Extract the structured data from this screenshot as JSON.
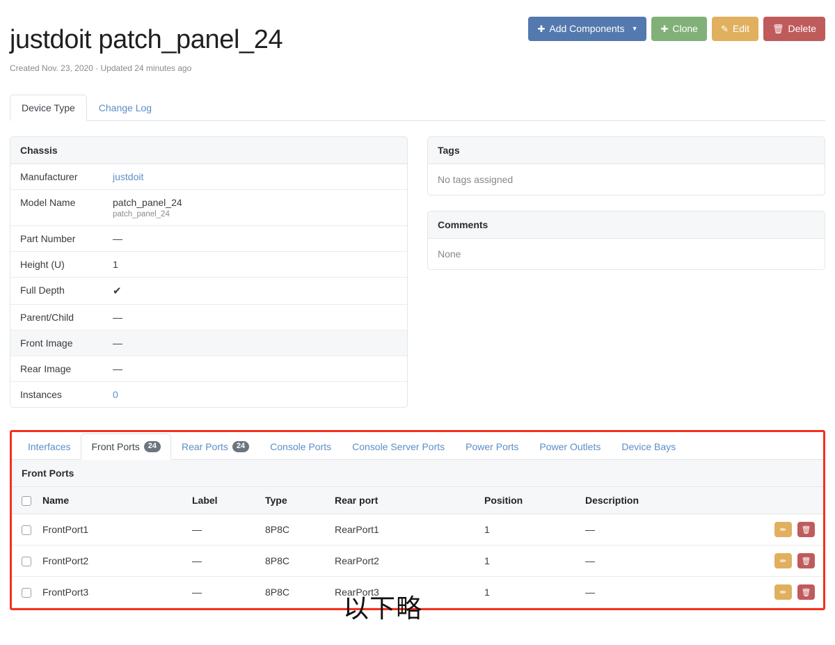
{
  "header": {
    "title": "justdoit patch_panel_24",
    "subtitle": "Created Nov. 23, 2020 · Updated 24 minutes ago",
    "buttons": [
      {
        "label": "Add Components",
        "icon": "plus-icon",
        "color": "#5479ae",
        "caret": true
      },
      {
        "label": "Clone",
        "icon": "plus-icon",
        "color": "#81b179",
        "caret": false
      },
      {
        "label": "Edit",
        "icon": "pencil-icon",
        "color": "#e0b05f",
        "caret": false
      },
      {
        "label": "Delete",
        "icon": "trash-icon",
        "color": "#bf5b5b",
        "caret": false
      }
    ]
  },
  "tabs": [
    {
      "label": "Device Type",
      "active": true
    },
    {
      "label": "Change Log",
      "active": false
    }
  ],
  "chassis": {
    "title": "Chassis",
    "rows": [
      {
        "key": "Manufacturer",
        "value": "justdoit",
        "link": true,
        "sub": ""
      },
      {
        "key": "Model Name",
        "value": "patch_panel_24",
        "link": false,
        "sub": "patch_panel_24"
      },
      {
        "key": "Part Number",
        "value": "—",
        "link": false,
        "sub": ""
      },
      {
        "key": "Height (U)",
        "value": "1",
        "link": false,
        "sub": ""
      },
      {
        "key": "Full Depth",
        "value": "✔",
        "link": false,
        "sub": ""
      },
      {
        "key": "Parent/Child",
        "value": "—",
        "link": false,
        "sub": ""
      },
      {
        "key": "Front Image",
        "value": "—",
        "link": false,
        "sub": ""
      },
      {
        "key": "Rear Image",
        "value": "—",
        "link": false,
        "sub": ""
      },
      {
        "key": "Instances",
        "value": "0",
        "link": true,
        "sub": ""
      }
    ]
  },
  "tags": {
    "title": "Tags",
    "body": "No tags assigned"
  },
  "comments": {
    "title": "Comments",
    "body": "None"
  },
  "components": {
    "tabs": [
      {
        "label": "Interfaces",
        "badge": "",
        "active": false
      },
      {
        "label": "Front Ports",
        "badge": "24",
        "active": true
      },
      {
        "label": "Rear Ports",
        "badge": "24",
        "active": false
      },
      {
        "label": "Console Ports",
        "badge": "",
        "active": false
      },
      {
        "label": "Console Server Ports",
        "badge": "",
        "active": false
      },
      {
        "label": "Power Ports",
        "badge": "",
        "active": false
      },
      {
        "label": "Power Outlets",
        "badge": "",
        "active": false
      },
      {
        "label": "Device Bays",
        "badge": "",
        "active": false
      }
    ],
    "panel_title": "Front Ports",
    "columns": [
      "Name",
      "Label",
      "Type",
      "Rear port",
      "Position",
      "Description"
    ],
    "rows": [
      {
        "name": "FrontPort1",
        "label": "—",
        "type": "8P8C",
        "rear_port": "RearPort1",
        "position": "1",
        "description": "—"
      },
      {
        "name": "FrontPort2",
        "label": "—",
        "type": "8P8C",
        "rear_port": "RearPort2",
        "position": "1",
        "description": "—"
      },
      {
        "name": "FrontPort3",
        "label": "—",
        "type": "8P8C",
        "rear_port": "RearPort3",
        "position": "1",
        "description": "—"
      }
    ],
    "row_actions": {
      "edit": "✏",
      "delete": "🗑"
    }
  },
  "annotation": {
    "text": "以下略",
    "highlight_color": "#f4301f"
  }
}
